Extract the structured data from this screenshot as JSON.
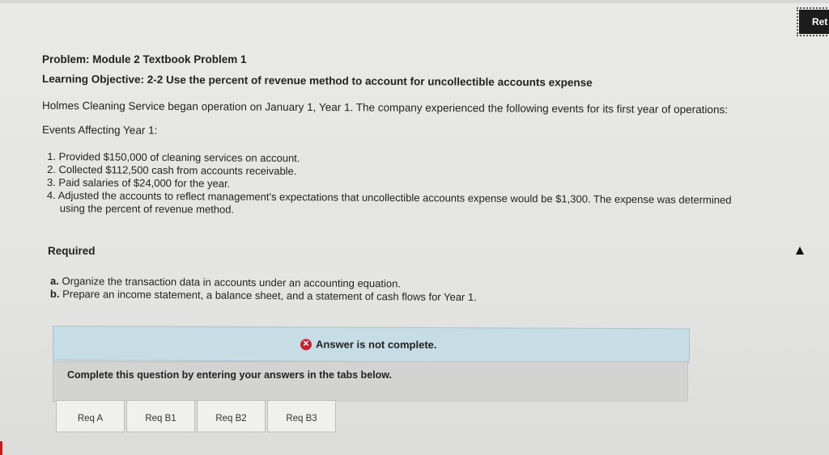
{
  "header": {
    "return_label": "Ret"
  },
  "problem": {
    "title": "Problem: Module 2 Textbook Problem 1",
    "objective": "Learning Objective: 2-2 Use the percent of revenue method to account for uncollectible accounts expense",
    "intro": "Holmes Cleaning Service began operation on January 1, Year 1. The company experienced the following events for its first year of operations:",
    "events_heading": "Events Affecting Year 1:",
    "events": [
      "1. Provided $150,000 of cleaning services on account.",
      "2. Collected $112,500 cash from accounts receivable.",
      "3. Paid salaries of $24,000 for the year.",
      "4. Adjusted the accounts to reflect management's expectations that uncollectible accounts expense would be $1,300. The expense was determined using the percent of revenue method."
    ]
  },
  "required": {
    "heading": "Required",
    "items": [
      {
        "letter": "a.",
        "text": "Organize the transaction data in accounts under an accounting equation."
      },
      {
        "letter": "b.",
        "text": "Prepare an income statement, a balance sheet, and a statement of cash flows for Year 1."
      }
    ]
  },
  "answer": {
    "status": "Answer is not complete.",
    "status_icon": "x-circle-icon",
    "status_color": "#c8202b",
    "instruction": "Complete this question by entering your answers in the tabs below."
  },
  "tabs": [
    {
      "label": "Req A"
    },
    {
      "label": "Req B1"
    },
    {
      "label": "Req B2"
    },
    {
      "label": "Req B3"
    }
  ]
}
